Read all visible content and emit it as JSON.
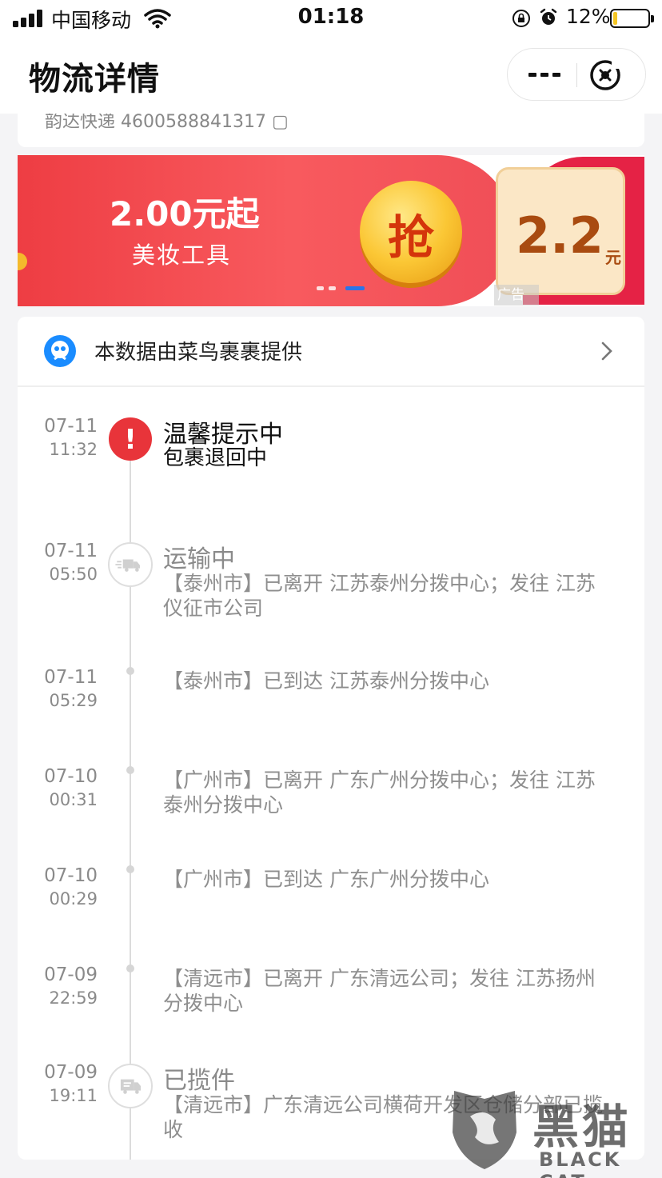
{
  "status_bar": {
    "carrier": "中国移动",
    "time": "01:18",
    "battery": "12%",
    "battery_level": 0.12
  },
  "nav": {
    "title": "物流详情",
    "more_icon": "ellipsis-icon",
    "close_icon": "close-circle-icon"
  },
  "top_card": {
    "cut_text": "韵达快递 4600588841317 ▢"
  },
  "banner": {
    "price": "2.00元起",
    "subtitle": "美妆工具",
    "coin_text": "抢",
    "coupon_amount": "2.2",
    "coupon_unit": "元",
    "ad_tag": "广告",
    "page_dots": 3,
    "active_dot": 3
  },
  "provider": {
    "text": "本数据由菜鸟裹裹提供",
    "logo_icon": "cainiao-logo-icon",
    "chevron_icon": "chevron-right-icon"
  },
  "timeline": [
    {
      "date": "07-11",
      "time": "11:32",
      "status": "温馨提示中",
      "detail": "包裹退回中",
      "node": "alert",
      "highlight": true
    },
    {
      "date": "07-11",
      "time": "05:50",
      "status": "运输中",
      "detail": "【泰州市】已离开 江苏泰州分拨中心；发往 江苏仪征市公司",
      "node": "truck-icon"
    },
    {
      "date": "07-11",
      "time": "05:29",
      "status": "",
      "detail": "【泰州市】已到达 江苏泰州分拨中心",
      "node": "dot"
    },
    {
      "date": "07-10",
      "time": "00:31",
      "status": "",
      "detail": "【广州市】已离开 广东广州分拨中心；发往 江苏泰州分拨中心",
      "node": "dot"
    },
    {
      "date": "07-10",
      "time": "00:29",
      "status": "",
      "detail": "【广州市】已到达 广东广州分拨中心",
      "node": "dot"
    },
    {
      "date": "07-09",
      "time": "22:59",
      "status": "",
      "detail": "【清远市】已离开 广东清远公司；发往 江苏扬州分拨中心",
      "node": "dot"
    },
    {
      "date": "07-09",
      "time": "19:11",
      "status": "已揽件",
      "detail": "【清远市】广东清远公司横荷开发区仓储分部已揽收",
      "node": "package-icon"
    }
  ],
  "watermark": {
    "cn": "黑猫",
    "en": "BLACK CAT"
  },
  "colors": {
    "alert_red": "#e8343a",
    "banner_red": "#f04e57",
    "coupon_brown": "#a94b10",
    "provider_blue": "#1a8cff"
  }
}
